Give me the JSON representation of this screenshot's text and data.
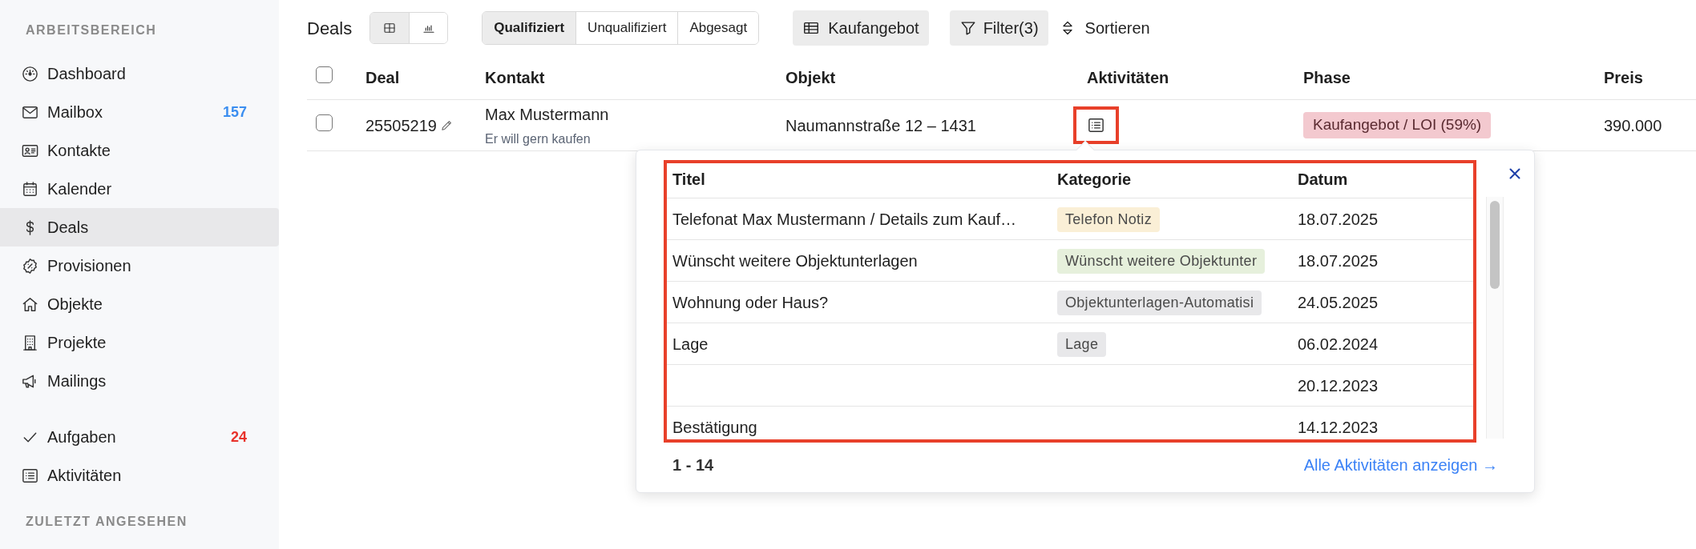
{
  "sidebar": {
    "groups": [
      {
        "heading": "ARBEITSBEREICH",
        "items": [
          {
            "label": "Dashboard",
            "selected": false
          },
          {
            "label": "Mailbox",
            "selected": false,
            "badge": {
              "text": "157",
              "color": "#3b8ef0"
            }
          },
          {
            "label": "Kontakte",
            "selected": false
          },
          {
            "label": "Kalender",
            "selected": false
          },
          {
            "label": "Deals",
            "selected": true
          },
          {
            "label": "Provisionen",
            "selected": false
          },
          {
            "label": "Objekte",
            "selected": false
          },
          {
            "label": "Projekte",
            "selected": false
          },
          {
            "label": "Mailings",
            "selected": false
          }
        ]
      },
      {
        "items": [
          {
            "label": "Aufgaben",
            "selected": false,
            "badge": {
              "text": "24",
              "color": "#e8322a"
            }
          },
          {
            "label": "Aktivitäten",
            "selected": false
          }
        ]
      },
      {
        "heading": "ZULETZT ANGESEHEN"
      }
    ]
  },
  "toolbar": {
    "title": "Deals",
    "view_toggle": [
      {
        "selected": true
      },
      {
        "selected": false
      }
    ],
    "status_filter": [
      {
        "label": "Qualifiziert",
        "selected": true
      },
      {
        "label": "Unqualifiziert",
        "selected": false
      },
      {
        "label": "Abgesagt",
        "selected": false
      }
    ],
    "pipeline_button": "Kaufangebot",
    "filter_button": "Filter(3)",
    "sort_button": "Sortieren"
  },
  "table": {
    "select_all_checked": false,
    "columns": [
      "Deal",
      "Kontakt",
      "Objekt",
      "Aktivitäten",
      "Phase",
      "Preis"
    ],
    "rows": [
      {
        "checked": false,
        "deal": "25505219",
        "contact": "Max Mustermann",
        "contact_note": "Er will gern kaufen",
        "object": "Naumannstraße 12 – 1431",
        "phase": "Kaufangebot / LOI (59%)",
        "price": "390.000"
      }
    ]
  },
  "activities_popup": {
    "columns": [
      "Titel",
      "Kategorie",
      "Datum"
    ],
    "rows": [
      {
        "title": "Telefonat Max Mustermann / Details zum Kauf…",
        "category": {
          "label": "Telefon Notiz",
          "color": "#faefd6"
        },
        "date": "18.07.2025"
      },
      {
        "title": "Wünscht weitere Objektunterlagen",
        "category": {
          "label": "Wünscht weitere Objektunter",
          "color": "#e6f0dc"
        },
        "date": "18.07.2025"
      },
      {
        "title": "Wohnung oder Haus?",
        "category": {
          "label": "Objektunterlagen-Automatisi",
          "color": "#e8e8ea"
        },
        "date": "24.05.2025"
      },
      {
        "title": "Lage",
        "category": {
          "label": "Lage",
          "color": "#e8e8ea"
        },
        "date": "06.02.2024"
      },
      {
        "date": "20.12.2023"
      },
      {
        "title": "Bestätigung",
        "date": "14.12.2023"
      }
    ],
    "range": "1 - 14",
    "link": "Alle Aktivitäten anzeigen →"
  }
}
